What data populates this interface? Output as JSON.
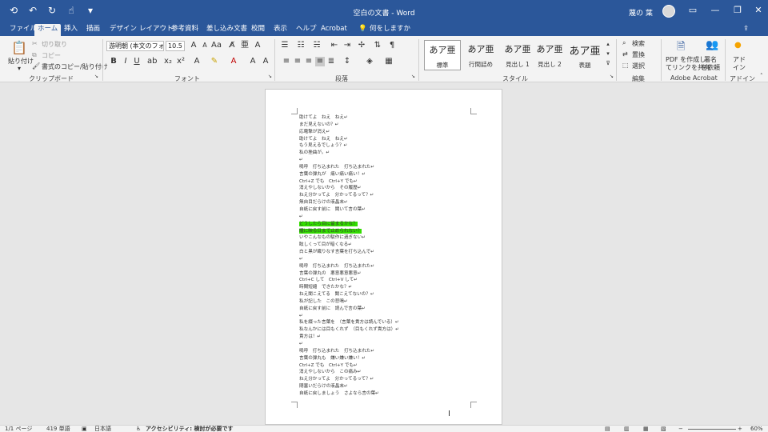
{
  "titlebar": {
    "document_title": "空白の文書 - Word",
    "user_name": "蔑の 葉",
    "qat_icons": [
      "autosave-icon",
      "undo-icon",
      "redo-icon",
      "touch-mode-icon",
      "customize-icon"
    ]
  },
  "tabs": [
    "ファイル",
    "ホーム",
    "挿入",
    "描画",
    "デザイン",
    "レイアウト",
    "参考資料",
    "差し込み文書",
    "校閲",
    "表示",
    "ヘルプ",
    "Acrobat",
    "何をしますか"
  ],
  "active_tab": "ホーム",
  "ribbon": {
    "clipboard": {
      "paste": "貼り付け",
      "cut": "切り取り",
      "copy": "コピー",
      "format_painter": "書式のコピー/貼り付け",
      "label": "クリップボード"
    },
    "font": {
      "font_name": "游明朝 (本文のフォン",
      "font_size": "10.5",
      "label": "フォント"
    },
    "paragraph": {
      "label": "段落"
    },
    "styles": {
      "items": [
        {
          "sample": "あア亜",
          "name": "標準"
        },
        {
          "sample": "あア亜",
          "name": "行間詰め"
        },
        {
          "sample": "あア亜",
          "name": "見出し 1"
        },
        {
          "sample": "あア亜",
          "name": "見出し 2"
        },
        {
          "sample": "あア亜",
          "name": "表題"
        }
      ],
      "label": "スタイル"
    },
    "editing": {
      "find": "検索",
      "replace": "置換",
      "select": "選択",
      "label": "編集"
    },
    "acrobat": {
      "create_pdf": [
        "PDF を作成し",
        "てリンクを共有"
      ],
      "sign": [
        "署名",
        "を依頼"
      ],
      "label": "Adobe Acrobat"
    },
    "addin": {
      "btn": [
        "アド",
        "イン"
      ],
      "label": "アドイン"
    }
  },
  "document_lines": [
    "助けてよ　ねえ　ねえ↵",
    "まだ見えないの？↵",
    "応電撃が消え↵",
    "助けてよ　ねえ　ねえ↵",
    "もう見えるでしょう？↵",
    "私の挫曲が。↵",
    "↵",
    "嗚呼　打ち込まれた　打ち込まれた↵",
    "言葉の弾丸が　痛い痛い痛い！↵",
    "Ctrl+Z でも　Ctrl+Y でも↵",
    "消えやしないから　その履歴↵",
    "ねえ分かってよ　分かってるって？↵",
    "無自目だらけの液晶末↵",
    "自紙に戻す前に　聞いて言の葉↵",
    "↵",
    "どうしたら目に留まるかな？",
    "瞳に映る日まで止められない？",
    "いやこんなもの駄作に過ぎない↵",
    "眩しくって目が暗くなる↵",
    "白と黒が織りなす言葉を打ち込んで↵",
    "↵",
    "嗚呼　打ち込まれた　打ち込まれた↵",
    "言葉の弾丸の　悪意悪意悪意↵",
    "Ctrl+C して　Ctrl+V して↵",
    "時間短縮　できたかな？↵",
    "ねえ聞こえてる　聞こえてないの？↵",
    "私が記した　この悲鳴↵",
    "自紙に戻す前に　読んで言の葉↵",
    "↵",
    "私を綴った言葉を　（言葉を貴方は読んでいる）↵",
    "私なんかには目もくれず　（目もくれず貴方は）↵",
    "貴方は！↵",
    "↵",
    "嗚呼　打ち込まれた　打ち込まれた↵",
    "言葉の弾丸も　嫌い嫌い嫌い！↵",
    "Ctrl+Z でも　Ctrl+Y でも↵",
    "消えやしないから　この痛み↵",
    "ねえ分かってよ　分かってるって？↵",
    "閉塞いだらけの液晶末↵",
    "自紙に戻しましょう　さよなら言の葉↵"
  ],
  "highlighted_lines": [
    15,
    16
  ],
  "statusbar": {
    "page": "1/1 ページ",
    "words": "419 単語",
    "language": "日本語",
    "accessibility": "アクセシビリティ: 検討が必要です",
    "zoom": "60%"
  }
}
